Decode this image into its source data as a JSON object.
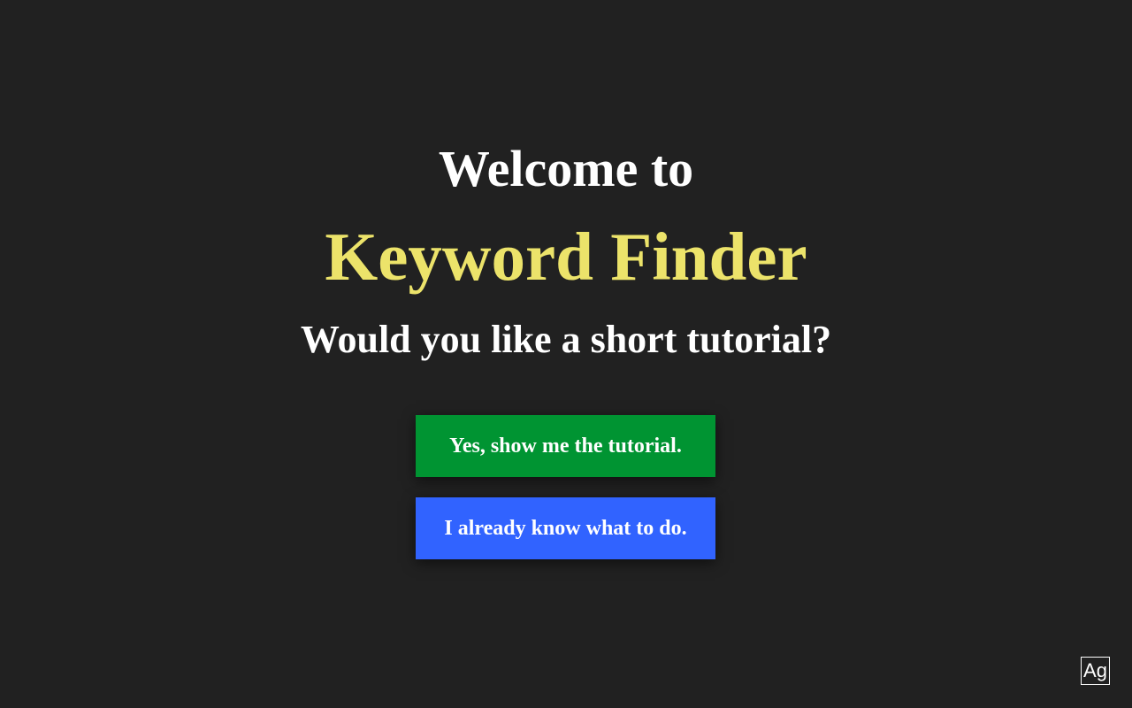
{
  "intro": {
    "welcome": "Welcome to",
    "app_name": "Keyword Finder",
    "question": "Would you like a short tutorial?"
  },
  "buttons": {
    "yes_label": "Yes, show me the tutorial.",
    "no_label": "I already know what to do."
  },
  "font_toggle": {
    "label": "Ag",
    "icon": "font-size-icon"
  },
  "colors": {
    "background": "#212121",
    "app_name": "#ece36a",
    "yes_button": "#009432",
    "no_button": "#3163ff",
    "text": "#ffffff"
  }
}
